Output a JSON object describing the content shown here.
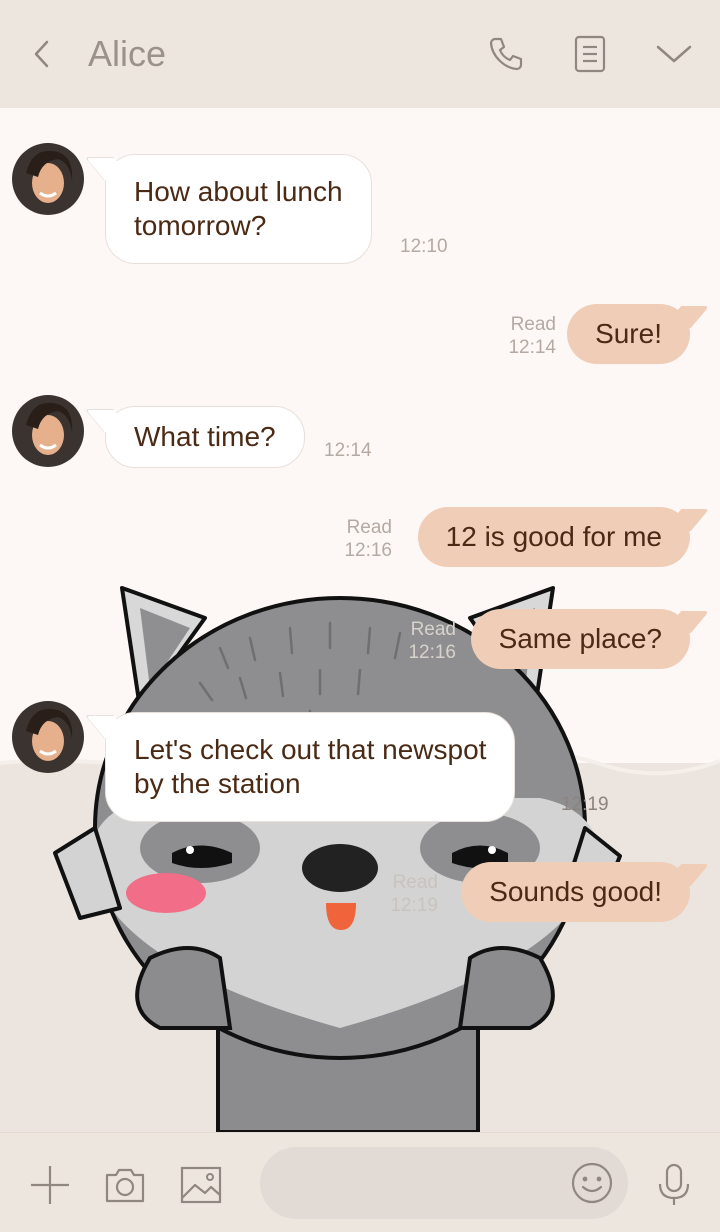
{
  "header": {
    "title": "Alice",
    "icons": [
      "chevron-left-icon",
      "phone-icon",
      "notes-icon",
      "chevron-down-icon"
    ]
  },
  "messages": [
    {
      "direction": "in",
      "text_line1": "How about lunch",
      "text_line2": "tomorrow?",
      "time": "12:10"
    },
    {
      "direction": "out",
      "text": "Sure!",
      "read": "Read",
      "time": "12:14"
    },
    {
      "direction": "in",
      "text": "What time?",
      "time": "12:14"
    },
    {
      "direction": "out",
      "text": "12 is good for me",
      "read": "Read",
      "time": "12:16"
    },
    {
      "direction": "out",
      "text": "Same place?",
      "read": "Read",
      "time": "12:16"
    },
    {
      "direction": "in",
      "text_line1": "Let's check out that newspot",
      "text_line2": "by the station",
      "time": "12:19"
    },
    {
      "direction": "out",
      "text": "Sounds good!",
      "read": "Read",
      "time": "12:19"
    }
  ],
  "footer": {
    "input_value": "",
    "icons": [
      "plus-icon",
      "camera-icon",
      "image-icon",
      "smiley-icon",
      "microphone-icon"
    ]
  },
  "colors": {
    "header_bg": "#ede6df",
    "chat_bg": "#fdf8f5",
    "incoming_bubble": "#ffffff",
    "outgoing_bubble": "#f0cdb6",
    "message_text": "#4a2a14",
    "meta_text": "#b4aaa3"
  }
}
